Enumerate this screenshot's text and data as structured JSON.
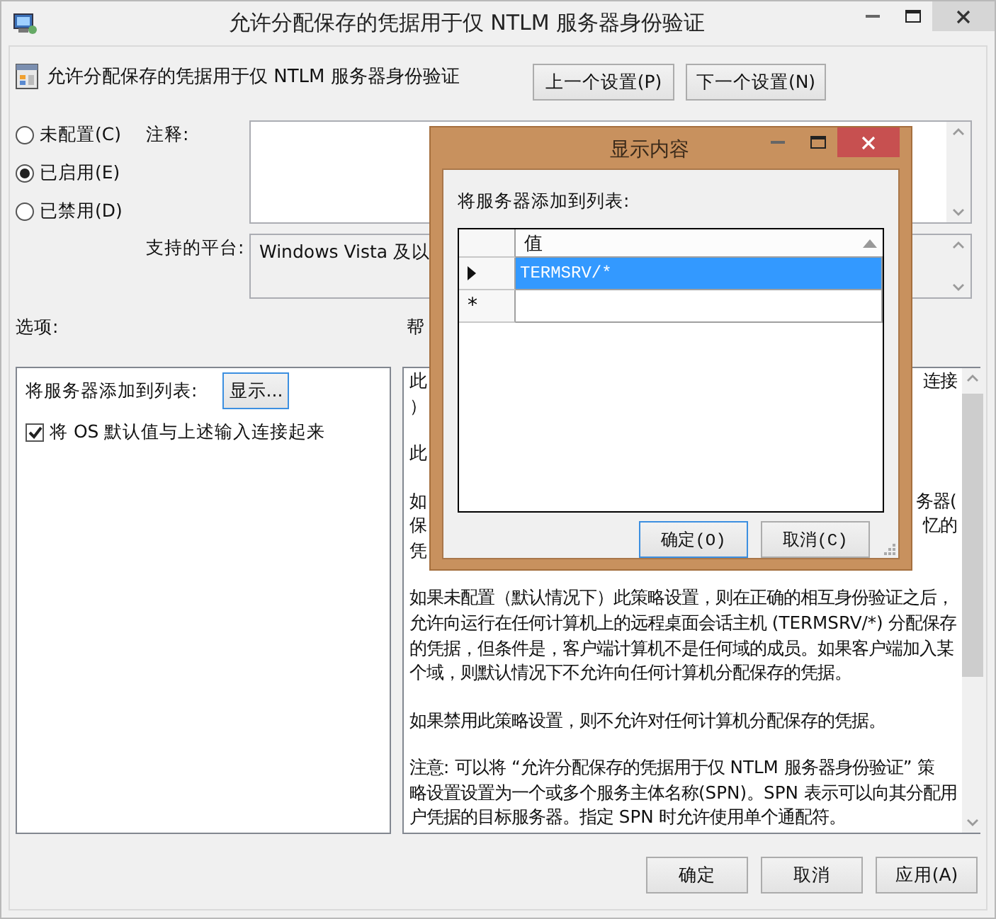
{
  "window": {
    "title": "允许分配保存的凭据用于仅 NTLM 服务器身份验证"
  },
  "header": {
    "title": "允许分配保存的凭据用于仅 NTLM 服务器身份验证",
    "buttons": [
      "上一个设置(P)",
      "下一个设置(N)"
    ]
  },
  "state_options": [
    {
      "label": "未配置(C)",
      "selected": false
    },
    {
      "label": "已启用(E)",
      "selected": true
    },
    {
      "label": "已禁用(D)",
      "selected": false
    }
  ],
  "comment": {
    "label": "注释:"
  },
  "platform": {
    "label": "支持的平台:",
    "value": "Windows Vista 及以"
  },
  "options": {
    "label": "选项:",
    "list_label": "将服务器添加到列表:",
    "show_button": "显示...",
    "concat_checkbox": {
      "label": "将 OS 默认值与上述输入连接起来",
      "checked": true
    }
  },
  "help": {
    "label": "帮",
    "covered_paragraphs": [
      [
        {
          "left": "此",
          "right": "连接"
        },
        {
          "left": "）"
        }
      ],
      [
        {
          "left": "此"
        }
      ],
      [
        {
          "left": "如",
          "right": "务器("
        },
        {
          "left": "保",
          "right": "忆的"
        },
        {
          "left": "凭"
        }
      ]
    ],
    "paragraphs": [
      [
        "如果未配置（默认情况下）此策略设置，则在正确的相互身份验证之后，",
        "允许向运行在任何计算机上的远程桌面会话主机 (TERMSRV/*) 分配保存",
        "的凭据，但条件是，客户端计算机不是任何域的成员。如果客户端加入某",
        "个域，则默认情况下不允许向任何计算机分配保存的凭据。"
      ],
      [
        "如果禁用此策略设置，则不允许对任何计算机分配保存的凭据。"
      ],
      [
        "注意: 可以将 “允许分配保存的凭据用于仅 NTLM 服务器身份验证” 策",
        "略设置设置为一个或多个服务主体名称(SPN)。SPN 表示可以向其分配用",
        "户凭据的目标服务器。指定 SPN 时允许使用单个通配符。"
      ]
    ]
  },
  "buttons": [
    "确定",
    "取消",
    "应用(A)"
  ],
  "dialog": {
    "title": "显示内容",
    "label": "将服务器添加到列表:",
    "column": "值",
    "rows": [
      {
        "kind": "entry",
        "value": "TERMSRV/*",
        "selected": true
      },
      {
        "kind": "new",
        "marker": "*"
      }
    ],
    "buttons": [
      "确定(O)",
      "取消(C)"
    ]
  }
}
